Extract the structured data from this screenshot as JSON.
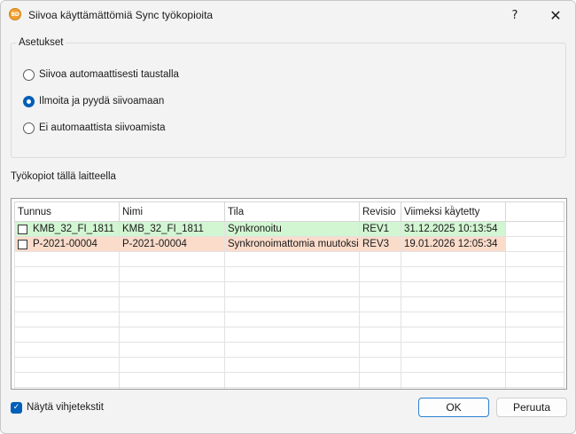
{
  "window": {
    "title": "Siivoa käyttämättömiä Sync työkopioita",
    "icon_text": "BD",
    "help_label": "?",
    "close_label": "✕"
  },
  "settings": {
    "group_label": "Asetukset",
    "options": [
      {
        "label": "Siivoa automaattisesti taustalla",
        "selected": false
      },
      {
        "label": "Ilmoita ja pyydä siivoamaan",
        "selected": true
      },
      {
        "label": "Ei automaattista siivoamista",
        "selected": false
      }
    ]
  },
  "working_copies": {
    "label": "Työkopiot tällä laitteella",
    "columns": [
      "Tunnus",
      "Nimi",
      "Tila",
      "Revisio",
      "Viimeksi käytetty"
    ],
    "sort_indicator": "⌄",
    "rows": [
      {
        "checked": false,
        "id": "KMB_32_FI_1811",
        "name": "KMB_32_FI_1811",
        "status": "Synkronoitu",
        "revision": "REV1",
        "last_used": "31.12.2025 10:13:54",
        "status_color": "#d2f5d2"
      },
      {
        "checked": false,
        "id": "P-2021-00004",
        "name": "P-2021-00004",
        "status": "Synkronoimattomia muutoksia",
        "revision": "REV3",
        "last_used": "19.01.2026 12:05:34",
        "status_color": "#fbdccb"
      }
    ]
  },
  "footer": {
    "show_tips_label": "Näytä vihjetekstit",
    "show_tips_checked": true,
    "ok_label": "OK",
    "cancel_label": "Peruuta"
  },
  "colors": {
    "accent": "#005fb8",
    "synced": "#d2f5d2",
    "unsynced": "#fbdccb"
  }
}
